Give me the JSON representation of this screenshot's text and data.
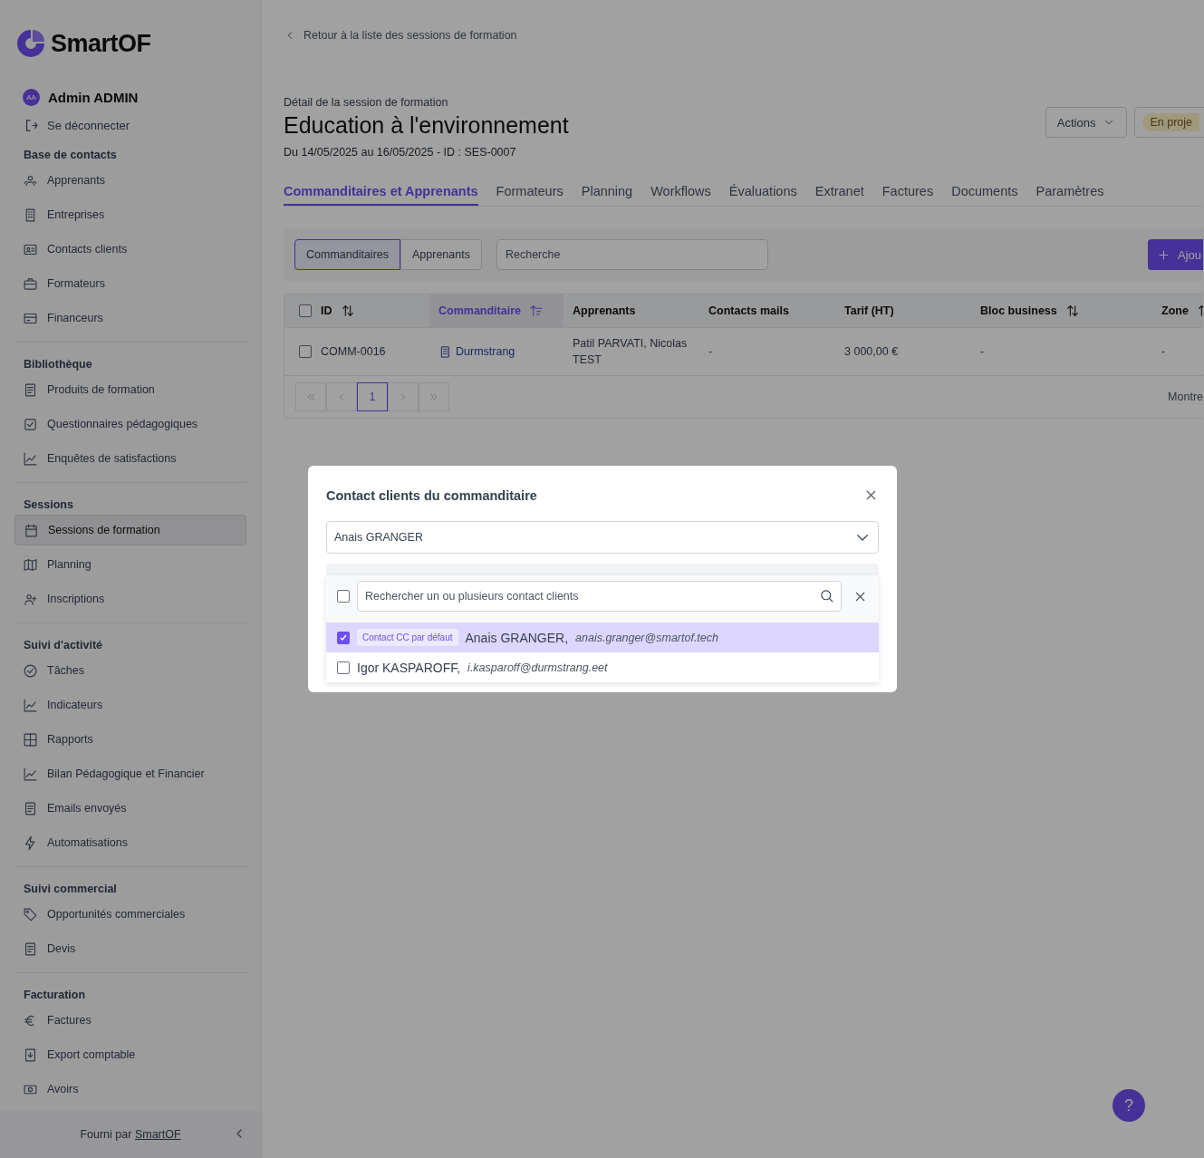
{
  "sidebar": {
    "logo": "SmartOF",
    "user": {
      "initials": "AA",
      "name": "Admin ADMIN"
    },
    "logout": "Se déconnecter",
    "sections": [
      {
        "title": "Base de contacts",
        "items": [
          {
            "label": "Apprenants",
            "selected": false
          },
          {
            "label": "Entreprises",
            "selected": false
          },
          {
            "label": "Contacts clients",
            "selected": false
          },
          {
            "label": "Formateurs",
            "selected": false
          },
          {
            "label": "Financeurs",
            "selected": false
          }
        ]
      },
      {
        "title": "Bibliothèque",
        "items": [
          {
            "label": "Produits de formation",
            "selected": false
          },
          {
            "label": "Questionnaires pédagogiques",
            "selected": false
          },
          {
            "label": "Enquêtes de satisfactions",
            "selected": false
          }
        ]
      },
      {
        "title": "Sessions",
        "items": [
          {
            "label": "Sessions de formation",
            "selected": true
          },
          {
            "label": "Planning",
            "selected": false
          },
          {
            "label": "Inscriptions",
            "selected": false
          }
        ]
      },
      {
        "title": "Suivi d'activité",
        "items": [
          {
            "label": "Tâches",
            "selected": false
          },
          {
            "label": "Indicateurs",
            "selected": false
          },
          {
            "label": "Rapports",
            "selected": false
          },
          {
            "label": "Bilan Pédagogique et Financier",
            "selected": false
          },
          {
            "label": "Emails envoyés",
            "selected": false
          },
          {
            "label": "Automatisations",
            "selected": false
          }
        ]
      },
      {
        "title": "Suivi commercial",
        "items": [
          {
            "label": "Opportunités commerciales",
            "selected": false
          },
          {
            "label": "Devis",
            "selected": false
          }
        ]
      },
      {
        "title": "Facturation",
        "items": [
          {
            "label": "Factures",
            "selected": false
          },
          {
            "label": "Export comptable",
            "selected": false
          },
          {
            "label": "Avoirs",
            "selected": false
          }
        ]
      }
    ],
    "footer": {
      "text": "Fourni par",
      "link": "SmartOF"
    }
  },
  "page": {
    "back_link": "Retour à la liste des sessions de formation",
    "subtitle": "Détail de la session de formation",
    "title": "Education à l'environnement",
    "dates": "Du 14/05/2025 au 16/05/2025 - ID : SES-0007",
    "actions_button": "Actions",
    "status_badge": "En proje",
    "tabs": [
      {
        "label": "Commanditaires et Apprenants",
        "selected": true
      },
      {
        "label": "Formateurs",
        "selected": false
      },
      {
        "label": "Planning",
        "selected": false
      },
      {
        "label": "Workflows",
        "selected": false
      },
      {
        "label": "Évaluations",
        "selected": false
      },
      {
        "label": "Extranet",
        "selected": false
      },
      {
        "label": "Factures",
        "selected": false
      },
      {
        "label": "Documents",
        "selected": false
      },
      {
        "label": "Paramètres",
        "selected": false
      }
    ],
    "toggle": [
      {
        "label": "Commanditaires",
        "selected": true
      },
      {
        "label": "Apprenants",
        "selected": false
      }
    ],
    "search": {
      "placeholder": "Recherche"
    },
    "add_button": "Ajou",
    "table": {
      "select_all": {
        "checked": false
      },
      "columns": [
        {
          "label": "ID",
          "sortable": true,
          "sorted": false
        },
        {
          "label": "Commanditaire",
          "sortable": true,
          "sorted": true
        },
        {
          "label": "Apprenants",
          "sortable": false,
          "sorted": false
        },
        {
          "label": "Contacts mails",
          "sortable": false,
          "sorted": false
        },
        {
          "label": "Tarif (HT)",
          "sortable": false,
          "sorted": false
        },
        {
          "label": "Bloc business",
          "sortable": true,
          "sorted": false
        },
        {
          "label": "Zone",
          "sortable": true,
          "sorted": false
        }
      ],
      "rows": [
        {
          "checked": false,
          "cells": [
            {
              "kind": "text",
              "text": "COMM-0016"
            },
            {
              "kind": "link",
              "text": "Durmstrang"
            },
            {
              "kind": "text",
              "text": "Patil PARVATI, Nicolas TEST"
            },
            {
              "kind": "text",
              "text": "-"
            },
            {
              "kind": "text",
              "text": "3 000,00 €"
            },
            {
              "kind": "text",
              "text": "-"
            },
            {
              "kind": "text",
              "text": "-"
            }
          ]
        }
      ]
    },
    "pagination": {
      "pages": [
        {
          "label": "1",
          "selected": true
        }
      ],
      "summary": "Montre"
    }
  },
  "help_button": "?",
  "modal": {
    "title": "Contact clients du commanditaire",
    "select": {
      "value": "Anais GRANGER"
    },
    "select_all": {
      "checked": false
    },
    "search": {
      "placeholder": "Rechercher un ou plusieurs contact clients"
    },
    "options": [
      {
        "checked": true,
        "selected": true,
        "badge": "Contact CC par défaut",
        "name": "Anais GRANGER,",
        "email": "anais.granger@smartof.tech"
      },
      {
        "checked": false,
        "selected": false,
        "name": "Igor KASPAROFF,",
        "email": "i.kasparoff@durmstrang.eet"
      }
    ]
  }
}
